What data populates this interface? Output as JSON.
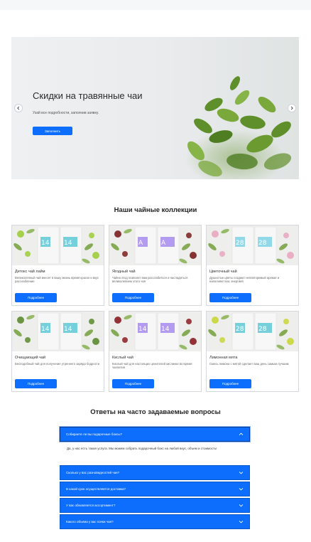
{
  "hero": {
    "title": "Скидки на травянные чаи",
    "subtitle": "Узай все подробности, заполнив заявку.",
    "button_label": "Заполнить"
  },
  "collections": {
    "title": "Наши чайные коллекции",
    "cards": [
      {
        "title": "Детокс чай лайм",
        "text": "Великолепный чай внесет в вашу жизнь время красок и вкус расслабление",
        "button": "Подробнее",
        "pack_number": "14",
        "pack_color": "#5fc9d6",
        "accent": "#9ccc3a"
      },
      {
        "title": "Ягодный чай",
        "text": "Чайно ягод позволит вам расслабиться и насладиться великолепием этого чая",
        "button": "Подробнее",
        "pack_number": "A",
        "pack_color": "#a78bf0",
        "accent": "#7a1f1f"
      },
      {
        "title": "Цветочный чай",
        "text": "Душистые цветы создают неповторимый аромат и наполняют вас энергией",
        "button": "Подробнее",
        "pack_number": "28",
        "pack_color": "#7fd3e6",
        "accent": "#e8a6c0"
      },
      {
        "title": "Очищающий чай",
        "text": "Бесподобный чай для получение утреннего заряда бодрости",
        "button": "Подробнее",
        "pack_number": "14",
        "pack_color": "#5fc9d6",
        "accent": "#5b8a2e"
      },
      {
        "title": "Кислый чай",
        "text": "Кислый чай для настоящих ценителей кислинки во время чаепития",
        "button": "Подробнее",
        "pack_number": "14",
        "pack_color": "#a78bf0",
        "accent": "#8a1d24"
      },
      {
        "title": "Лимонная мята",
        "text": "Смесь лимона с мятой сделает ваш день самым лучшим",
        "button": "Подробнее",
        "pack_number": "28",
        "pack_color": "#5fc9d6",
        "accent": "#c8d63a"
      }
    ]
  },
  "faq": {
    "title": "Ответы на часто задаваемые вопросы",
    "items": [
      {
        "question": "Собираете ли вы подарочные боксы?",
        "open": true
      },
      {
        "question": "Сколько у вас разновидностей чая?",
        "open": false
      },
      {
        "question": "В какой срок осуществляется доставка?",
        "open": false
      },
      {
        "question": "У вас обновляется ассортимент?",
        "open": false
      },
      {
        "question": "Какого объема у вас пачки чая?",
        "open": false
      }
    ],
    "answer": "Да, у нас есть такая услуга. Мы можем собрать подарочный бокс на любой вкус, объем и стоимость!"
  },
  "colors": {
    "primary": "#0d6efd"
  },
  "icons": {
    "carousel_prev": "chevron-left-icon",
    "carousel_next": "chevron-right-icon",
    "faq_open": "chevron-up-icon",
    "faq_closed": "chevron-down-icon"
  }
}
